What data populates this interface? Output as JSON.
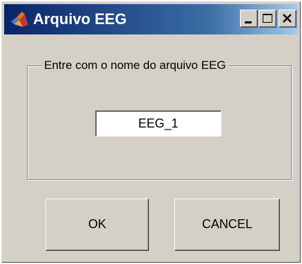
{
  "window": {
    "title": "Arquivo EEG",
    "icon": "matlab-logo-icon"
  },
  "titlebar_buttons": {
    "minimize": "minimize-icon",
    "maximize": "maximize-icon",
    "close": "close-icon"
  },
  "group": {
    "label": "Entre com o nome do arquivo EEG"
  },
  "filename_field": {
    "value": "EEG_1"
  },
  "buttons": {
    "ok_label": "OK",
    "cancel_label": "CANCEL"
  },
  "colors": {
    "titlebar_start": "#0a246a",
    "titlebar_end": "#a6caf0",
    "dialog_face": "#d4d0c8"
  }
}
